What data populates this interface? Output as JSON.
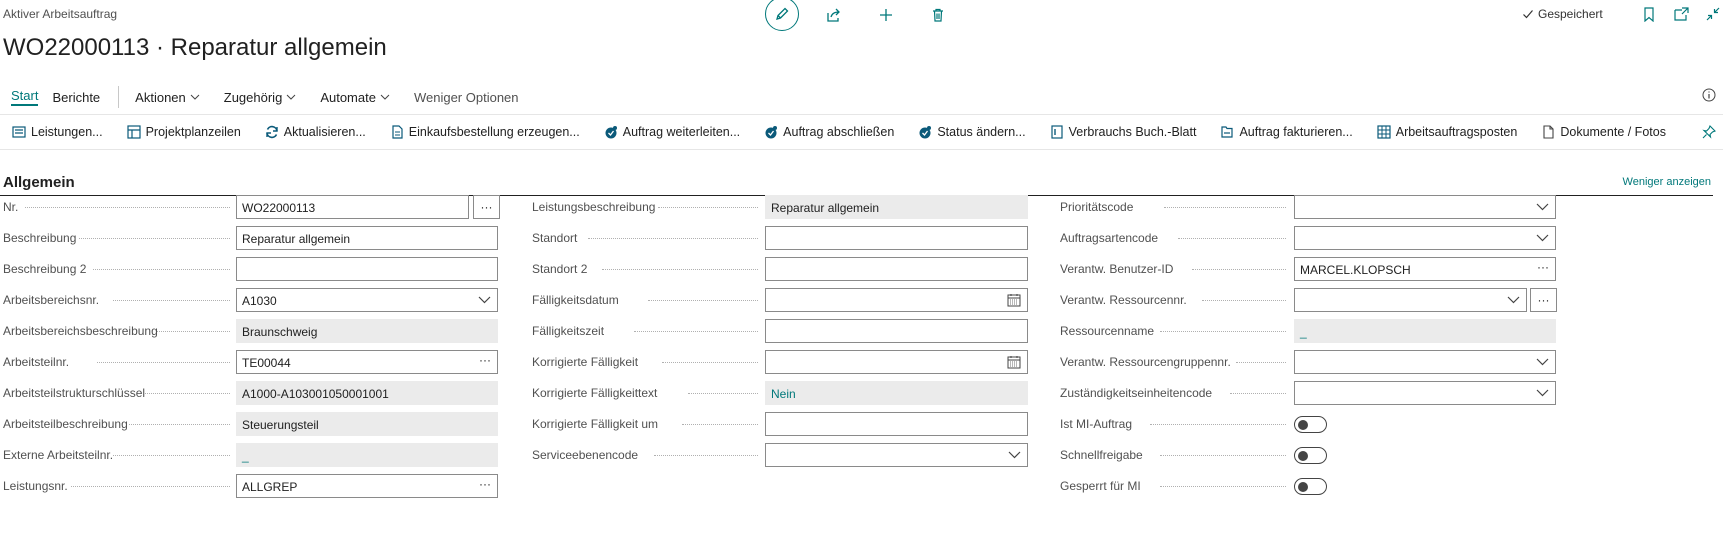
{
  "header": {
    "caption": "Aktiver Arbeitsauftrag",
    "title": "WO22000113 · Reparatur allgemein",
    "saved_label": "Gespeichert"
  },
  "icons": {
    "edit": "pencil-icon",
    "share": "share-icon",
    "add": "plus-icon",
    "delete": "trash-icon",
    "bookmark": "bookmark-icon",
    "open_new": "open-in-new-window-icon",
    "collapse": "collapse-icon",
    "info": "info-icon",
    "pin": "pin-icon"
  },
  "colors": {
    "accent": "#00787a",
    "text": "#212121",
    "label": "#505050",
    "readonly_bg": "#ebebeb"
  },
  "tabs": {
    "start": "Start",
    "berichte": "Berichte",
    "aktionen": "Aktionen",
    "zugehoerig": "Zugehörig",
    "automate": "Automate",
    "weniger": "Weniger Optionen"
  },
  "actions": [
    "Leistungen...",
    "Projektplanzeilen",
    "Aktualisieren...",
    "Einkaufsbestellung erzeugen...",
    "Auftrag weiterleiten...",
    "Auftrag abschließen",
    "Status ändern...",
    "Verbrauchs Buch.-Blatt",
    "Auftrag fakturieren...",
    "Arbeitsauftragsposten",
    "Dokumente / Fotos"
  ],
  "section": {
    "title": "Allgemein",
    "toggle_link": "Weniger anzeigen"
  },
  "col1": [
    {
      "label": "Nr.",
      "value": "WO22000113"
    },
    {
      "label": "Beschreibung",
      "value": "Reparatur allgemein"
    },
    {
      "label": "Beschreibung 2",
      "value": ""
    },
    {
      "label": "Arbeitsbereichsnr.",
      "value": "A1030"
    },
    {
      "label": "Arbeitsbereichsbeschreibung",
      "value": "Braunschweig"
    },
    {
      "label": "Arbeitsteilnr.",
      "value": "TE00044"
    },
    {
      "label": "Arbeitsteilstrukturschlüssel",
      "value": "A1000-A103001050001001"
    },
    {
      "label": "Arbeitsteilbeschreibung",
      "value": "Steuerungsteil"
    },
    {
      "label": "Externe Arbeitsteilnr.",
      "value": "_"
    },
    {
      "label": "Leistungsnr.",
      "value": "ALLGREP"
    }
  ],
  "col2": [
    {
      "label": "Leistungsbeschreibung",
      "value": "Reparatur allgemein"
    },
    {
      "label": "Standort",
      "value": ""
    },
    {
      "label": "Standort 2",
      "value": ""
    },
    {
      "label": "Fälligkeitsdatum",
      "value": ""
    },
    {
      "label": "Fälligkeitszeit",
      "value": ""
    },
    {
      "label": "Korrigierte Fälligkeit",
      "value": ""
    },
    {
      "label": "Korrigierte Fälligkeittext",
      "value": "Nein"
    },
    {
      "label": "Korrigierte Fälligkeit um",
      "value": ""
    },
    {
      "label": "Serviceebenencode",
      "value": ""
    }
  ],
  "col3": [
    {
      "label": "Prioritätscode",
      "value": ""
    },
    {
      "label": "Auftragsartencode",
      "value": ""
    },
    {
      "label": "Verantw. Benutzer-ID",
      "value": "MARCEL.KLOPSCH"
    },
    {
      "label": "Verantw. Ressourcennr.",
      "value": ""
    },
    {
      "label": "Ressourcenname",
      "value": "_"
    },
    {
      "label": "Verantw. Ressourcengruppennr.",
      "value": ""
    },
    {
      "label": "Zuständigkeitseinheitencode",
      "value": ""
    },
    {
      "label": "Ist MI-Auftrag",
      "value": false
    },
    {
      "label": "Schnellfreigabe",
      "value": false
    },
    {
      "label": "Gesperrt für MI",
      "value": false
    }
  ]
}
